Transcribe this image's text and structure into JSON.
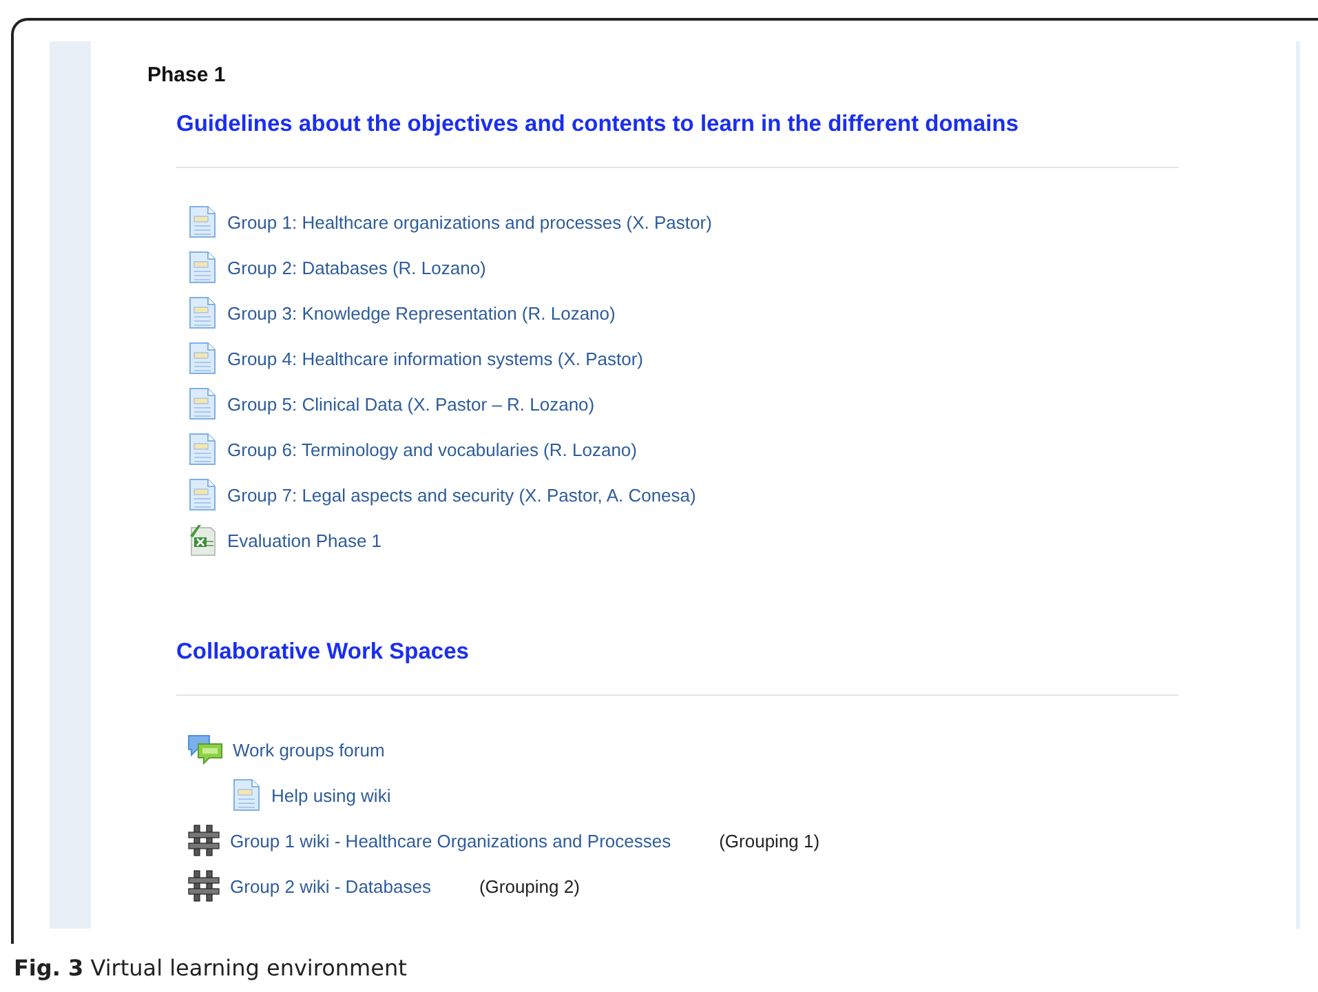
{
  "phase_title": "Phase 1",
  "sections": [
    {
      "title": "Guidelines about the objectives and contents to learn in the different domains",
      "items": [
        {
          "kind": "document",
          "label": "Group 1: Healthcare organizations and processes (X. Pastor)"
        },
        {
          "kind": "document",
          "label": "Group 2: Databases (R. Lozano)"
        },
        {
          "kind": "document",
          "label": "Group 3: Knowledge Representation (R. Lozano)"
        },
        {
          "kind": "document",
          "label": "Group 4: Healthcare information systems (X. Pastor)"
        },
        {
          "kind": "document",
          "label": "Group 5: Clinical Data (X. Pastor – R. Lozano)"
        },
        {
          "kind": "document",
          "label": "Group 6: Terminology and vocabularies (R. Lozano)"
        },
        {
          "kind": "document",
          "label": "Group 7: Legal aspects and security (X. Pastor, A. Conesa)"
        },
        {
          "kind": "spreadsheet",
          "label": "Evaluation Phase 1"
        }
      ]
    },
    {
      "title": "Collaborative Work Spaces",
      "items": [
        {
          "kind": "forum",
          "label": "Work groups forum",
          "children": [
            {
              "kind": "document",
              "label": "Help using wiki"
            }
          ]
        },
        {
          "kind": "wiki",
          "label": "Group 1 wiki - Healthcare Organizations and Processes",
          "note": "(Grouping 1)"
        },
        {
          "kind": "wiki",
          "label": "Group 2 wiki - Databases",
          "note": "(Grouping 2)"
        }
      ]
    }
  ],
  "caption": "**Fig. 3** Virtual learning environment"
}
